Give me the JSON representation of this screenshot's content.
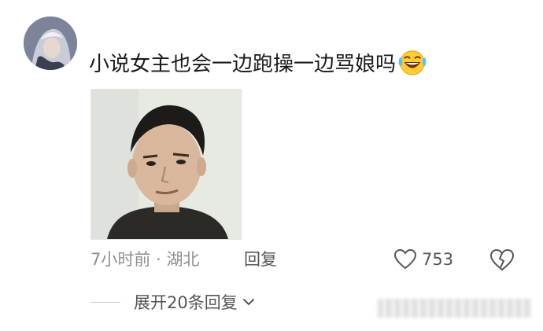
{
  "comment": {
    "author_name": "",
    "text": "小说女主也会一边跑操一边骂娘吗",
    "emoji": "laughing-crying-emoji"
  },
  "meta": {
    "time": "7小时前",
    "separator": "·",
    "location": "湖北",
    "reply_label": "回复"
  },
  "actions": {
    "like_count": "753"
  },
  "replies": {
    "expand_label": "展开20条回复"
  },
  "colors": {
    "text_primary": "#1a1a1a",
    "text_secondary": "#8f8f8f",
    "action_text": "#555555",
    "background": "#ffffff"
  }
}
